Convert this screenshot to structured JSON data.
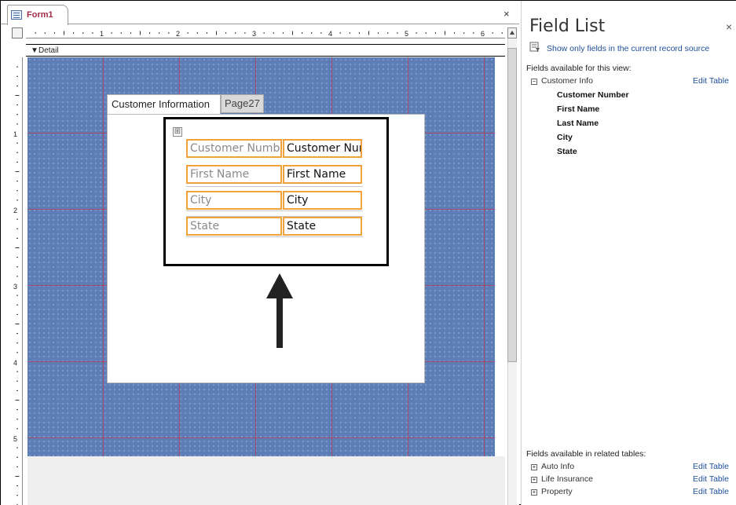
{
  "document": {
    "tab_label": "Form1",
    "close_symbol": "×"
  },
  "section": {
    "arrow": "▼",
    "label": "Detail"
  },
  "ruler": {
    "h_numbers": [
      "1",
      "2",
      "3",
      "4",
      "5",
      "6"
    ],
    "v_numbers": [
      "1",
      "2",
      "3",
      "4",
      "5"
    ]
  },
  "form": {
    "tabs": [
      {
        "label": "Customer Information",
        "selected": true
      },
      {
        "label": "Page27",
        "selected": false
      }
    ],
    "move_handle_symbol": "⊞",
    "rows": [
      {
        "label": "Customer Number",
        "textbox": "Customer Num"
      },
      {
        "label": "First Name",
        "textbox": "First Name"
      },
      {
        "label": "City",
        "textbox": "City"
      },
      {
        "label": "State",
        "textbox": "State"
      }
    ]
  },
  "field_list": {
    "title": "Field List",
    "close_symbol": "×",
    "show_only_link": "Show only fields in the current record source",
    "available_heading": "Fields available for this view:",
    "table": {
      "expander": "−",
      "name": "Customer Info",
      "edit_label": "Edit Table"
    },
    "fields": [
      "Customer Number",
      "First Name",
      "Last Name",
      "City",
      "State"
    ],
    "related_heading": "Fields available in related tables:",
    "related_tables": [
      {
        "expander": "+",
        "name": "Auto Info",
        "edit_label": "Edit Table"
      },
      {
        "expander": "+",
        "name": "Life Insurance",
        "edit_label": "Edit Table"
      },
      {
        "expander": "+",
        "name": "Property",
        "edit_label": "Edit Table"
      }
    ]
  },
  "colors": {
    "detail_background": "#5c7db6",
    "grid_line": "#a64a6a",
    "control_border": "#f1a23c",
    "link": "#1f4f98",
    "tab_title": "#a02c48"
  }
}
